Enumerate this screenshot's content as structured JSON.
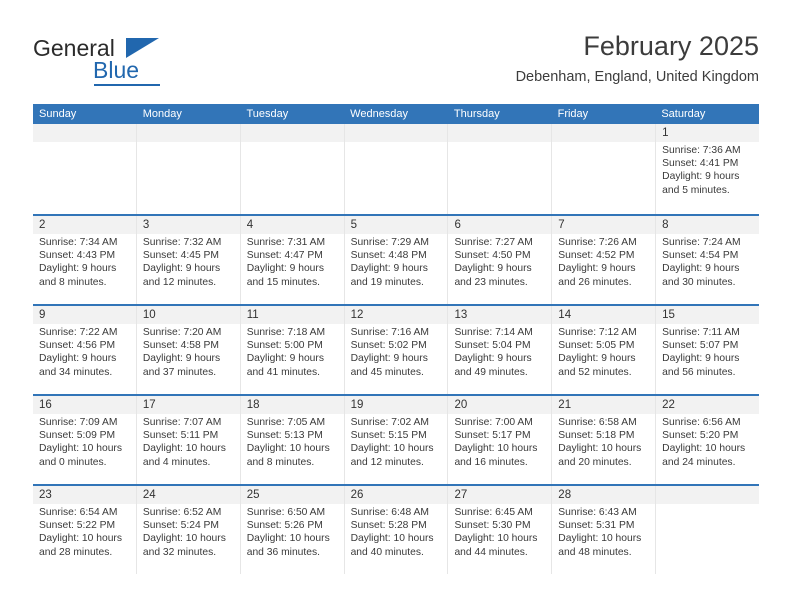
{
  "brand": {
    "name_part1": "General",
    "name_part2": "Blue",
    "logo_icon": "triangle-icon",
    "color_blue": "#2167ae",
    "color_dark": "#2b2b2b"
  },
  "header": {
    "title": "February 2025",
    "subtitle": "Debenham, England, United Kingdom"
  },
  "calendar": {
    "header_color": "#3275b8",
    "band_color": "#f2f2f2",
    "weekdays": [
      "Sunday",
      "Monday",
      "Tuesday",
      "Wednesday",
      "Thursday",
      "Friday",
      "Saturday"
    ],
    "weeks": [
      [
        {
          "day": "",
          "sunrise": "",
          "sunset": "",
          "daylight": "",
          "daylight2": ""
        },
        {
          "day": "",
          "sunrise": "",
          "sunset": "",
          "daylight": "",
          "daylight2": ""
        },
        {
          "day": "",
          "sunrise": "",
          "sunset": "",
          "daylight": "",
          "daylight2": ""
        },
        {
          "day": "",
          "sunrise": "",
          "sunset": "",
          "daylight": "",
          "daylight2": ""
        },
        {
          "day": "",
          "sunrise": "",
          "sunset": "",
          "daylight": "",
          "daylight2": ""
        },
        {
          "day": "",
          "sunrise": "",
          "sunset": "",
          "daylight": "",
          "daylight2": ""
        },
        {
          "day": "1",
          "sunrise": "Sunrise: 7:36 AM",
          "sunset": "Sunset: 4:41 PM",
          "daylight": "Daylight: 9 hours",
          "daylight2": "and 5 minutes."
        }
      ],
      [
        {
          "day": "2",
          "sunrise": "Sunrise: 7:34 AM",
          "sunset": "Sunset: 4:43 PM",
          "daylight": "Daylight: 9 hours",
          "daylight2": "and 8 minutes."
        },
        {
          "day": "3",
          "sunrise": "Sunrise: 7:32 AM",
          "sunset": "Sunset: 4:45 PM",
          "daylight": "Daylight: 9 hours",
          "daylight2": "and 12 minutes."
        },
        {
          "day": "4",
          "sunrise": "Sunrise: 7:31 AM",
          "sunset": "Sunset: 4:47 PM",
          "daylight": "Daylight: 9 hours",
          "daylight2": "and 15 minutes."
        },
        {
          "day": "5",
          "sunrise": "Sunrise: 7:29 AM",
          "sunset": "Sunset: 4:48 PM",
          "daylight": "Daylight: 9 hours",
          "daylight2": "and 19 minutes."
        },
        {
          "day": "6",
          "sunrise": "Sunrise: 7:27 AM",
          "sunset": "Sunset: 4:50 PM",
          "daylight": "Daylight: 9 hours",
          "daylight2": "and 23 minutes."
        },
        {
          "day": "7",
          "sunrise": "Sunrise: 7:26 AM",
          "sunset": "Sunset: 4:52 PM",
          "daylight": "Daylight: 9 hours",
          "daylight2": "and 26 minutes."
        },
        {
          "day": "8",
          "sunrise": "Sunrise: 7:24 AM",
          "sunset": "Sunset: 4:54 PM",
          "daylight": "Daylight: 9 hours",
          "daylight2": "and 30 minutes."
        }
      ],
      [
        {
          "day": "9",
          "sunrise": "Sunrise: 7:22 AM",
          "sunset": "Sunset: 4:56 PM",
          "daylight": "Daylight: 9 hours",
          "daylight2": "and 34 minutes."
        },
        {
          "day": "10",
          "sunrise": "Sunrise: 7:20 AM",
          "sunset": "Sunset: 4:58 PM",
          "daylight": "Daylight: 9 hours",
          "daylight2": "and 37 minutes."
        },
        {
          "day": "11",
          "sunrise": "Sunrise: 7:18 AM",
          "sunset": "Sunset: 5:00 PM",
          "daylight": "Daylight: 9 hours",
          "daylight2": "and 41 minutes."
        },
        {
          "day": "12",
          "sunrise": "Sunrise: 7:16 AM",
          "sunset": "Sunset: 5:02 PM",
          "daylight": "Daylight: 9 hours",
          "daylight2": "and 45 minutes."
        },
        {
          "day": "13",
          "sunrise": "Sunrise: 7:14 AM",
          "sunset": "Sunset: 5:04 PM",
          "daylight": "Daylight: 9 hours",
          "daylight2": "and 49 minutes."
        },
        {
          "day": "14",
          "sunrise": "Sunrise: 7:12 AM",
          "sunset": "Sunset: 5:05 PM",
          "daylight": "Daylight: 9 hours",
          "daylight2": "and 52 minutes."
        },
        {
          "day": "15",
          "sunrise": "Sunrise: 7:11 AM",
          "sunset": "Sunset: 5:07 PM",
          "daylight": "Daylight: 9 hours",
          "daylight2": "and 56 minutes."
        }
      ],
      [
        {
          "day": "16",
          "sunrise": "Sunrise: 7:09 AM",
          "sunset": "Sunset: 5:09 PM",
          "daylight": "Daylight: 10 hours",
          "daylight2": "and 0 minutes."
        },
        {
          "day": "17",
          "sunrise": "Sunrise: 7:07 AM",
          "sunset": "Sunset: 5:11 PM",
          "daylight": "Daylight: 10 hours",
          "daylight2": "and 4 minutes."
        },
        {
          "day": "18",
          "sunrise": "Sunrise: 7:05 AM",
          "sunset": "Sunset: 5:13 PM",
          "daylight": "Daylight: 10 hours",
          "daylight2": "and 8 minutes."
        },
        {
          "day": "19",
          "sunrise": "Sunrise: 7:02 AM",
          "sunset": "Sunset: 5:15 PM",
          "daylight": "Daylight: 10 hours",
          "daylight2": "and 12 minutes."
        },
        {
          "day": "20",
          "sunrise": "Sunrise: 7:00 AM",
          "sunset": "Sunset: 5:17 PM",
          "daylight": "Daylight: 10 hours",
          "daylight2": "and 16 minutes."
        },
        {
          "day": "21",
          "sunrise": "Sunrise: 6:58 AM",
          "sunset": "Sunset: 5:18 PM",
          "daylight": "Daylight: 10 hours",
          "daylight2": "and 20 minutes."
        },
        {
          "day": "22",
          "sunrise": "Sunrise: 6:56 AM",
          "sunset": "Sunset: 5:20 PM",
          "daylight": "Daylight: 10 hours",
          "daylight2": "and 24 minutes."
        }
      ],
      [
        {
          "day": "23",
          "sunrise": "Sunrise: 6:54 AM",
          "sunset": "Sunset: 5:22 PM",
          "daylight": "Daylight: 10 hours",
          "daylight2": "and 28 minutes."
        },
        {
          "day": "24",
          "sunrise": "Sunrise: 6:52 AM",
          "sunset": "Sunset: 5:24 PM",
          "daylight": "Daylight: 10 hours",
          "daylight2": "and 32 minutes."
        },
        {
          "day": "25",
          "sunrise": "Sunrise: 6:50 AM",
          "sunset": "Sunset: 5:26 PM",
          "daylight": "Daylight: 10 hours",
          "daylight2": "and 36 minutes."
        },
        {
          "day": "26",
          "sunrise": "Sunrise: 6:48 AM",
          "sunset": "Sunset: 5:28 PM",
          "daylight": "Daylight: 10 hours",
          "daylight2": "and 40 minutes."
        },
        {
          "day": "27",
          "sunrise": "Sunrise: 6:45 AM",
          "sunset": "Sunset: 5:30 PM",
          "daylight": "Daylight: 10 hours",
          "daylight2": "and 44 minutes."
        },
        {
          "day": "28",
          "sunrise": "Sunrise: 6:43 AM",
          "sunset": "Sunset: 5:31 PM",
          "daylight": "Daylight: 10 hours",
          "daylight2": "and 48 minutes."
        },
        {
          "day": "",
          "sunrise": "",
          "sunset": "",
          "daylight": "",
          "daylight2": ""
        }
      ]
    ]
  }
}
